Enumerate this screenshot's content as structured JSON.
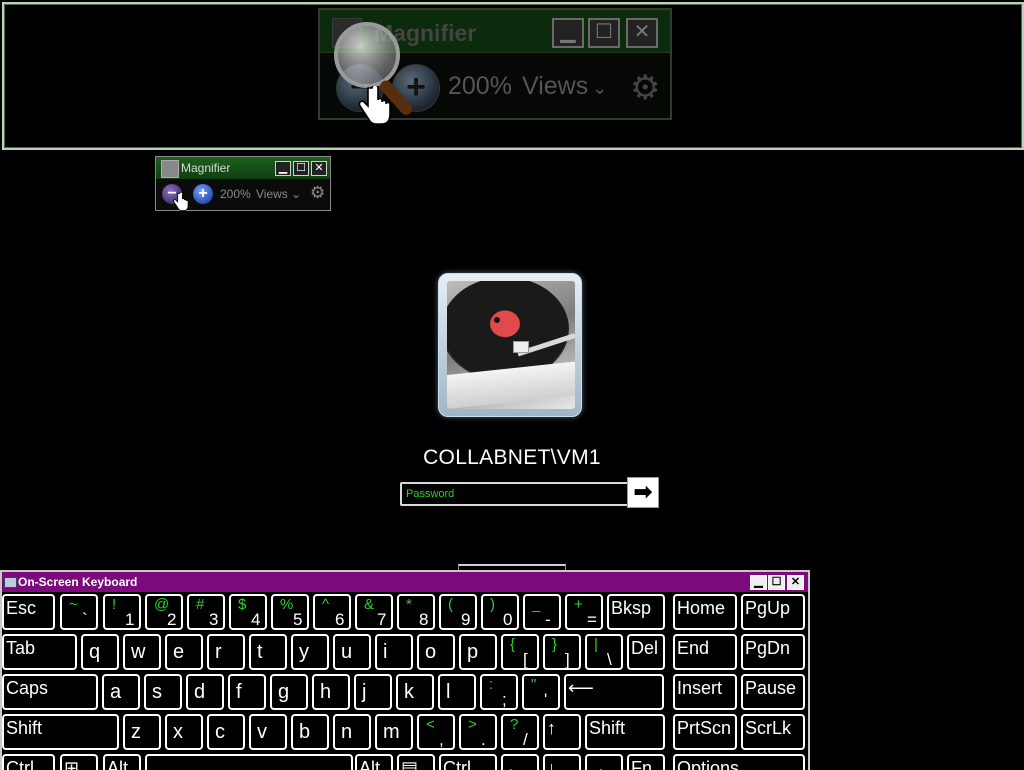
{
  "magnifier": {
    "title": "Magnifier",
    "zoom_level": "200%",
    "views_label": "Views",
    "zoom_out_symbol": "−",
    "zoom_in_symbol": "+",
    "minimize_symbol": "▁",
    "maximize_symbol": "☐",
    "close_symbol": "✕",
    "chevron_symbol": "⌄",
    "gear_symbol": "⚙"
  },
  "logon": {
    "user_name": "COLLABNET\\VM1",
    "password_placeholder": "Password",
    "submit_symbol": "➡"
  },
  "keyboard": {
    "title": "On-Screen Keyboard",
    "minimize_symbol": "▁",
    "maximize_symbol": "☐",
    "close_symbol": "✕",
    "rows": [
      [
        {
          "label": "Esc"
        },
        {
          "up": "~",
          "dn": "`"
        },
        {
          "up": "!",
          "dn": "1"
        },
        {
          "up": "@",
          "dn": "2"
        },
        {
          "up": "#",
          "dn": "3"
        },
        {
          "up": "$",
          "dn": "4"
        },
        {
          "up": "%",
          "dn": "5"
        },
        {
          "up": "^",
          "dn": "6"
        },
        {
          "up": "&",
          "dn": "7"
        },
        {
          "up": "*",
          "dn": "8"
        },
        {
          "up": "(",
          "dn": "9"
        },
        {
          "up": ")",
          "dn": "0"
        },
        {
          "up": "_",
          "dn": "-"
        },
        {
          "up": "+",
          "dn": "="
        },
        {
          "label": "Bksp"
        },
        {
          "label": "Home"
        },
        {
          "label": "PgUp"
        }
      ],
      [
        {
          "label": "Tab"
        },
        {
          "label": "q"
        },
        {
          "label": "w"
        },
        {
          "label": "e"
        },
        {
          "label": "r"
        },
        {
          "label": "t"
        },
        {
          "label": "y"
        },
        {
          "label": "u"
        },
        {
          "label": "i"
        },
        {
          "label": "o"
        },
        {
          "label": "p"
        },
        {
          "up": "{",
          "dn": "["
        },
        {
          "up": "}",
          "dn": "]"
        },
        {
          "up": "|",
          "dn": "\\"
        },
        {
          "label": "Del"
        },
        {
          "label": "End"
        },
        {
          "label": "PgDn"
        }
      ],
      [
        {
          "label": "Caps"
        },
        {
          "label": "a"
        },
        {
          "label": "s"
        },
        {
          "label": "d"
        },
        {
          "label": "f"
        },
        {
          "label": "g"
        },
        {
          "label": "h"
        },
        {
          "label": "j"
        },
        {
          "label": "k"
        },
        {
          "label": "l"
        },
        {
          "up": ":",
          "dn": ";"
        },
        {
          "up": "\"",
          "dn": "'"
        },
        {
          "label": "⟵"
        },
        {
          "label": "Insert"
        },
        {
          "label": "Pause"
        }
      ],
      [
        {
          "label": "Shift"
        },
        {
          "label": "z"
        },
        {
          "label": "x"
        },
        {
          "label": "c"
        },
        {
          "label": "v"
        },
        {
          "label": "b"
        },
        {
          "label": "n"
        },
        {
          "label": "m"
        },
        {
          "up": "<",
          "dn": ","
        },
        {
          "up": ">",
          "dn": "."
        },
        {
          "up": "?",
          "dn": "/"
        },
        {
          "label": "↑"
        },
        {
          "label": "Shift"
        },
        {
          "label": "PrtScn"
        },
        {
          "label": "ScrLk"
        }
      ],
      [
        {
          "label": "Ctrl"
        },
        {
          "label": "⊞"
        },
        {
          "label": "Alt"
        },
        {
          "label": ""
        },
        {
          "label": "Alt"
        },
        {
          "label": "▤"
        },
        {
          "label": "Ctrl"
        },
        {
          "label": "←"
        },
        {
          "label": "↓"
        },
        {
          "label": "→"
        },
        {
          "label": "Fn"
        },
        {
          "label": "Options"
        }
      ]
    ]
  }
}
